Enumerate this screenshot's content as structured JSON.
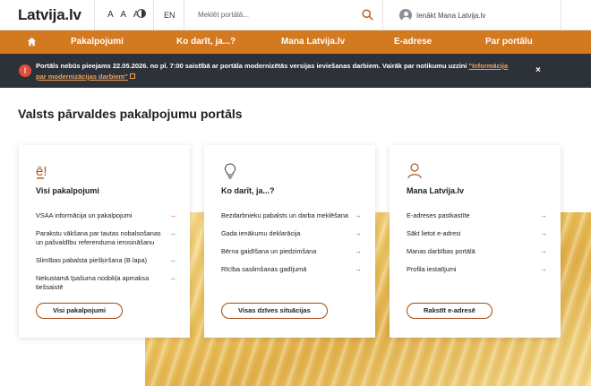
{
  "header": {
    "logo": "Latvija.lv",
    "font_size_label": "A A A",
    "contrast_icon": "contrast-icon",
    "language": "EN",
    "search": {
      "placeholder": "Meklēt portālā...",
      "icon": "search-icon"
    },
    "login_label": "Ienākt Mana Latvija.lv"
  },
  "nav": {
    "home_icon": "home-icon",
    "items": [
      {
        "label": "Pakalpojumi"
      },
      {
        "label": "Ko darīt, ja...?"
      },
      {
        "label": "Mana Latvija.lv"
      },
      {
        "label": "E-adrese"
      },
      {
        "label": "Par portālu"
      }
    ]
  },
  "alert": {
    "text": "Portāls nebūs pieejams 22.05.2026. no pl. 7:00 saistībā ar portāla modernizētās versijas ieviešanas darbiem. Vairāk par notikumu uzzini ",
    "link_text": "\"Informācija par modernizācijas darbiem\"",
    "close": "×"
  },
  "page_title": "Valsts pārvaldes pakalpojumu portāls",
  "cards": [
    {
      "icon": "e-services-icon",
      "title": "Visi pakalpojumi",
      "links": [
        "VSAA informācija un pakalpojumi",
        "Parakstu vākšana par tautas nobalsošanas un pašvaldību referenduma ierosināšanu",
        "Slimības pabalsta piešķiršana (B lapa)",
        "Nekustamā īpašuma nodokļa apmaksa tiešsaistē"
      ],
      "button": "Visi pakalpojumi"
    },
    {
      "icon": "lightbulb-icon",
      "title": "Ko darīt, ja...?",
      "links": [
        "Bezdarbnieku pabalsts un darba meklēšana",
        "Gada ienākumu deklarācija",
        "Bērna gaidīšana un piedzimšana",
        "Rīcība saslimšanas gadījumā"
      ],
      "button": "Visas dzīves situācijas"
    },
    {
      "icon": "user-icon",
      "title": "Mana Latvija.lv",
      "links": [
        "E-adreses pastkastīte",
        "Sākt lietot e-adresi",
        "Manas darbības portālā",
        "Profila iestatījumi"
      ],
      "button": "Rakstīt e-adresē"
    }
  ],
  "colors": {
    "accent": "#d3791f",
    "alert_bg": "#2d3138",
    "link": "#d35400"
  }
}
